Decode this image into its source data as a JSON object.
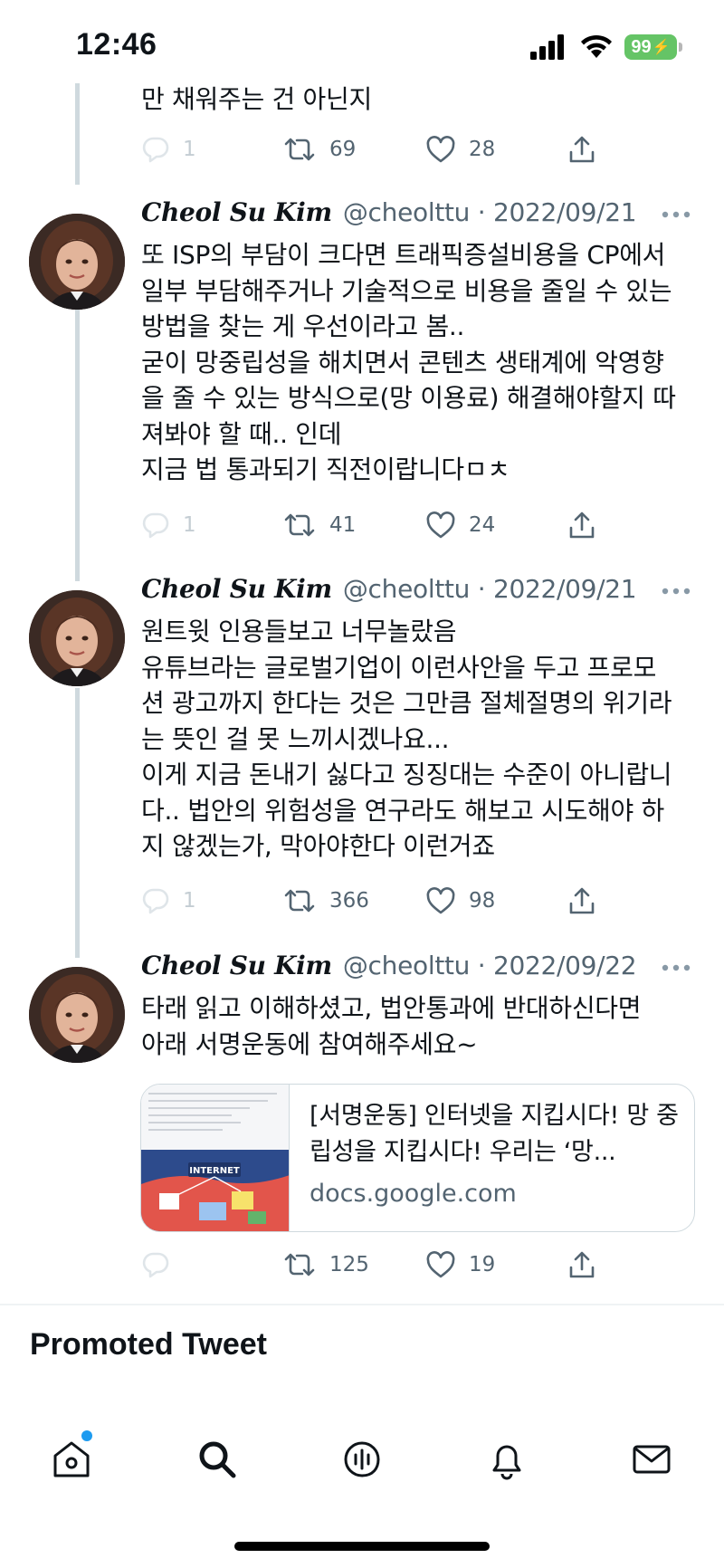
{
  "status_bar": {
    "time": "12:46",
    "battery": "99"
  },
  "top_fragment": {
    "text": "만 채워주는 건 아닌지",
    "actions": {
      "replies": "1",
      "retweets": "69",
      "likes": "28"
    }
  },
  "tweets": [
    {
      "name": "Cheol Su Kim",
      "handle": "@cheolttu",
      "date": "2022/09/21",
      "text": "또 ISP의 부담이 크다면 트래픽증설비용을 CP에서\n일부 부담해주거나 기술적으로 비용을 줄일 수 있는\n방법을 찾는 게 우선이라고 봄..\n굳이 망중립성을 해치면서 콘텐츠 생태계에 악영향\n을 줄 수 있는 방식으로(망 이용료) 해결해야할지 따\n져봐야 할 때.. 인데\n지금 법 통과되기 직전이랍니다ㅁㅊ",
      "actions": {
        "replies": "1",
        "retweets": "41",
        "likes": "24"
      }
    },
    {
      "name": "Cheol Su Kim",
      "handle": "@cheolttu",
      "date": "2022/09/21",
      "text": "원트윗 인용들보고 너무놀랐음\n유튜브라는 글로벌기업이 이런사안을 두고 프로모\n션 광고까지 한다는 것은 그만큼 절체절명의 위기라\n는 뜻인 걸 못 느끼시겠나요...\n이게 지금 돈내기 싫다고 징징대는 수준이 아니랍니\n다.. 법안의 위험성을 연구라도 해보고 시도해야 하\n지 않겠는가, 막아야한다 이런거죠",
      "actions": {
        "replies": "1",
        "retweets": "366",
        "likes": "98"
      }
    },
    {
      "name": "Cheol Su Kim",
      "handle": "@cheolttu",
      "date": "2022/09/22",
      "text": "타래 읽고 이해하셨고, 법안통과에 반대하신다면\n아래 서명운동에 참여해주세요~",
      "link_card": {
        "title": "[서명운동] 인터넷을 지킵시다! 망 중립성을 지킵시다! 우리는 ‘망...",
        "domain": "docs.google.com",
        "thumb_label": "INTERNET"
      },
      "actions": {
        "replies": "",
        "retweets": "125",
        "likes": "19"
      }
    }
  ],
  "promoted_label": "Promoted Tweet",
  "tabbar": [
    "home-icon",
    "search-icon",
    "spaces-icon",
    "notifications-icon",
    "messages-icon"
  ],
  "colors": {
    "accent": "#1d9bf0",
    "text": "#0f1419",
    "muted": "#536471",
    "thread": "#cfd9de",
    "battery": "#65c466"
  }
}
